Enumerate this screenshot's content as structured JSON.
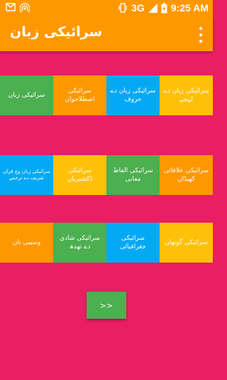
{
  "status_bar": {
    "network": "3G",
    "time": "9:25 AM",
    "icons": [
      "mail-icon",
      "hotspot-icon",
      "vibrate-icon",
      "signal-icon",
      "battery-icon"
    ]
  },
  "app_bar": {
    "title": "سرائیکی زبان",
    "menu_icon": "overflow-menu-icon"
  },
  "colors": {
    "background": "#e91e63",
    "app_bar": "#ff9800",
    "green": "#4caf50",
    "orange": "#ff9800",
    "blue": "#03a9f4",
    "yellow": "#ffc107"
  },
  "rows": [
    {
      "tiles": [
        {
          "label": "سرائیکی زبان",
          "color": "green"
        },
        {
          "label": "سرائیکی اصطلاحوان",
          "color": "orange"
        },
        {
          "label": "سرائیکی زبان دے حروف",
          "color": "blue"
        },
        {
          "label": "سرائیکی زبان دے لہجے",
          "color": "yellow"
        }
      ]
    },
    {
      "tiles": [
        {
          "label": "سرائیکی زبان وچ قران شریف دے ترجمے",
          "color": "blue"
        },
        {
          "label": "سرائیکی ڈکشنریاں",
          "color": "yellow"
        },
        {
          "label": "سرائیکی الفاظ معانی",
          "color": "green"
        },
        {
          "label": "سرائیکی علاقائی کھیڈاں",
          "color": "orange"
        }
      ]
    },
    {
      "tiles": [
        {
          "label": "وسیبی ناں",
          "color": "orange"
        },
        {
          "label": "سرائیکی شادی دے تھدھ",
          "color": "green"
        },
        {
          "label": "سرائیکی جغرافیائی",
          "color": "blue"
        },
        {
          "label": "سرائیکی گوتھاں",
          "color": "yellow"
        }
      ]
    }
  ],
  "next_button": {
    "label": ">>"
  }
}
